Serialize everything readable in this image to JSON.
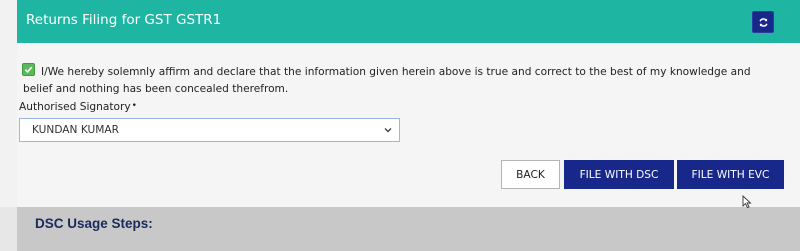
{
  "header": {
    "title": "Returns Filing for GST GSTR1",
    "refresh_icon": "refresh-icon",
    "color": "#1fb5a3"
  },
  "declaration": {
    "checked": true,
    "text": "I/We hereby solemnly affirm and declare that the information given herein above is true and correct to the best of my knowledge and belief and nothing has been concealed therefrom."
  },
  "signatory": {
    "label": "Authorised Signatory",
    "required_marker": "•",
    "selected": "KUNDAN KUMAR"
  },
  "buttons": {
    "back": "BACK",
    "file_dsc": "FILE WITH DSC",
    "file_evc": "FILE WITH EVC",
    "primary_color": "#17288a"
  },
  "dsc_section": {
    "title": "DSC Usage Steps:"
  }
}
